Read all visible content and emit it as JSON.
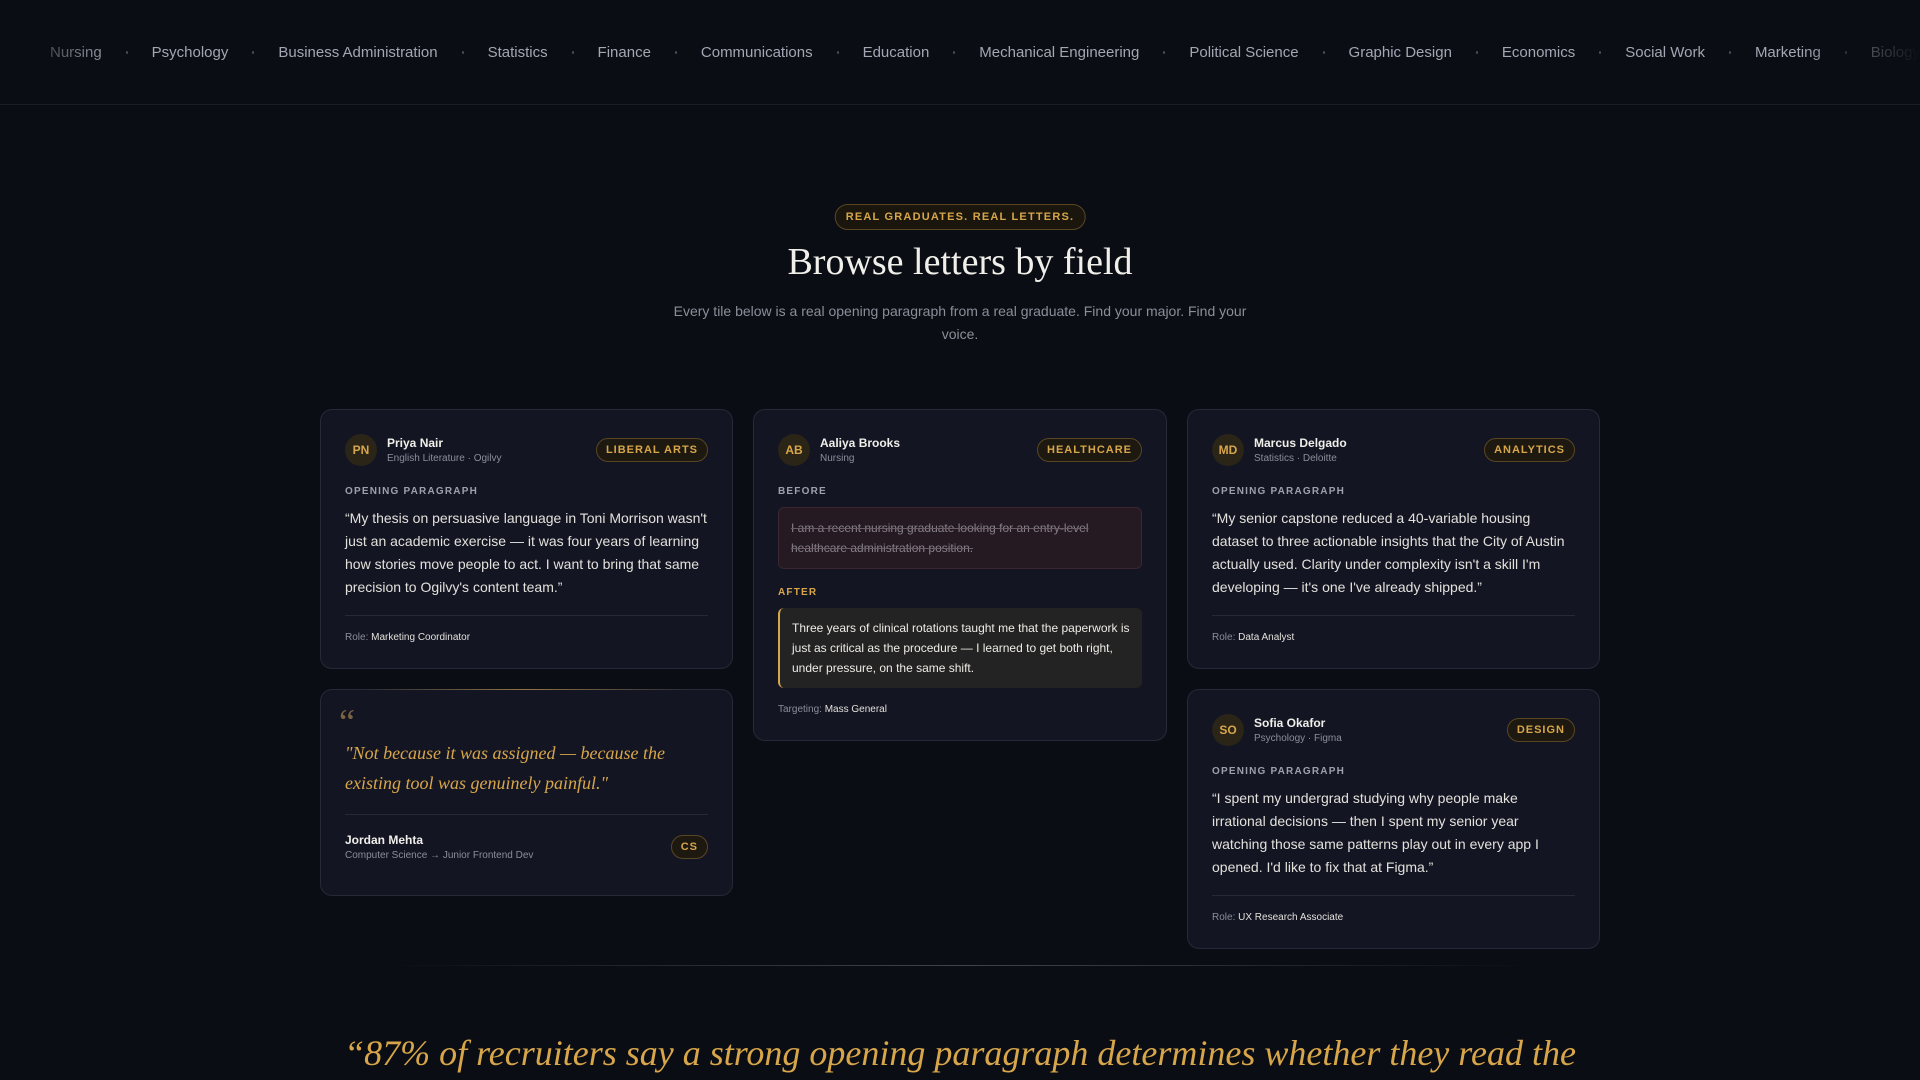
{
  "fields_nav": [
    "Nursing",
    "Psychology",
    "Business Administration",
    "Statistics",
    "Finance",
    "Communications",
    "Education",
    "Mechanical Engineering",
    "Political Science",
    "Graphic Design",
    "Economics",
    "Social Work",
    "Marketing",
    "Biology"
  ],
  "header": {
    "eyebrow": "REAL GRADUATES. REAL LETTERS.",
    "title": "Browse letters by field",
    "subtitle": "Every tile below is a real opening paragraph from a real graduate. Find your major. Find your voice."
  },
  "cards": {
    "priya": {
      "initials": "PN",
      "name": "Priya Nair",
      "sub": "English Literature · Ogilvy",
      "tag": "LIBERAL ARTS",
      "label": "OPENING PARAGRAPH",
      "text": "“My thesis on persuasive language in Toni Morrison wasn't just an academic exercise — it was four years of learning how stories move people to act. I want to bring that same precision to Ogilvy's content team.”",
      "meta_key": "Role:",
      "meta_val": "Marketing Coordinator"
    },
    "jordan": {
      "quote_mark": "“",
      "quote": "\"Not because it was assigned — because the existing tool was genuinely painful.\"",
      "name": "Jordan Mehta",
      "sub": "Computer Science → Junior Frontend Dev",
      "tag": "CS"
    },
    "aaliya": {
      "initials": "AB",
      "name": "Aaliya Brooks",
      "sub": "Nursing",
      "tag": "HEALTHCARE",
      "before_label": "BEFORE",
      "before_text": "I am a recent nursing graduate looking for an entry-level healthcare administration position.",
      "after_label": "AFTER",
      "after_text": "Three years of clinical rotations taught me that the paperwork is just as critical as the procedure — I learned to get both right, under pressure, on the same shift.",
      "meta_key": "Targeting:",
      "meta_val": "Mass General"
    },
    "marcus": {
      "initials": "MD",
      "name": "Marcus Delgado",
      "sub": "Statistics · Deloitte",
      "tag": "ANALYTICS",
      "label": "OPENING PARAGRAPH",
      "text": "“My senior capstone reduced a 40-variable housing dataset to three actionable insights that the City of Austin actually used. Clarity under complexity isn't a skill I'm developing — it's one I've already shipped.”",
      "meta_key": "Role:",
      "meta_val": "Data Analyst"
    },
    "sofia": {
      "initials": "SO",
      "name": "Sofia Okafor",
      "sub": "Psychology · Figma",
      "tag": "DESIGN",
      "label": "OPENING PARAGRAPH",
      "text": "“I spent my undergrad studying why people make irrational decisions — then I spent my senior year watching those same patterns play out in every app I opened. I'd like to fix that at Figma.”",
      "meta_key": "Role:",
      "meta_val": "UX Research Associate"
    }
  },
  "big_quote": "“87% of recruiters say a strong opening paragraph determines whether they read the",
  "colors": {
    "background": "#0b0d14",
    "accent": "#d8a64a",
    "card": "#131522"
  }
}
